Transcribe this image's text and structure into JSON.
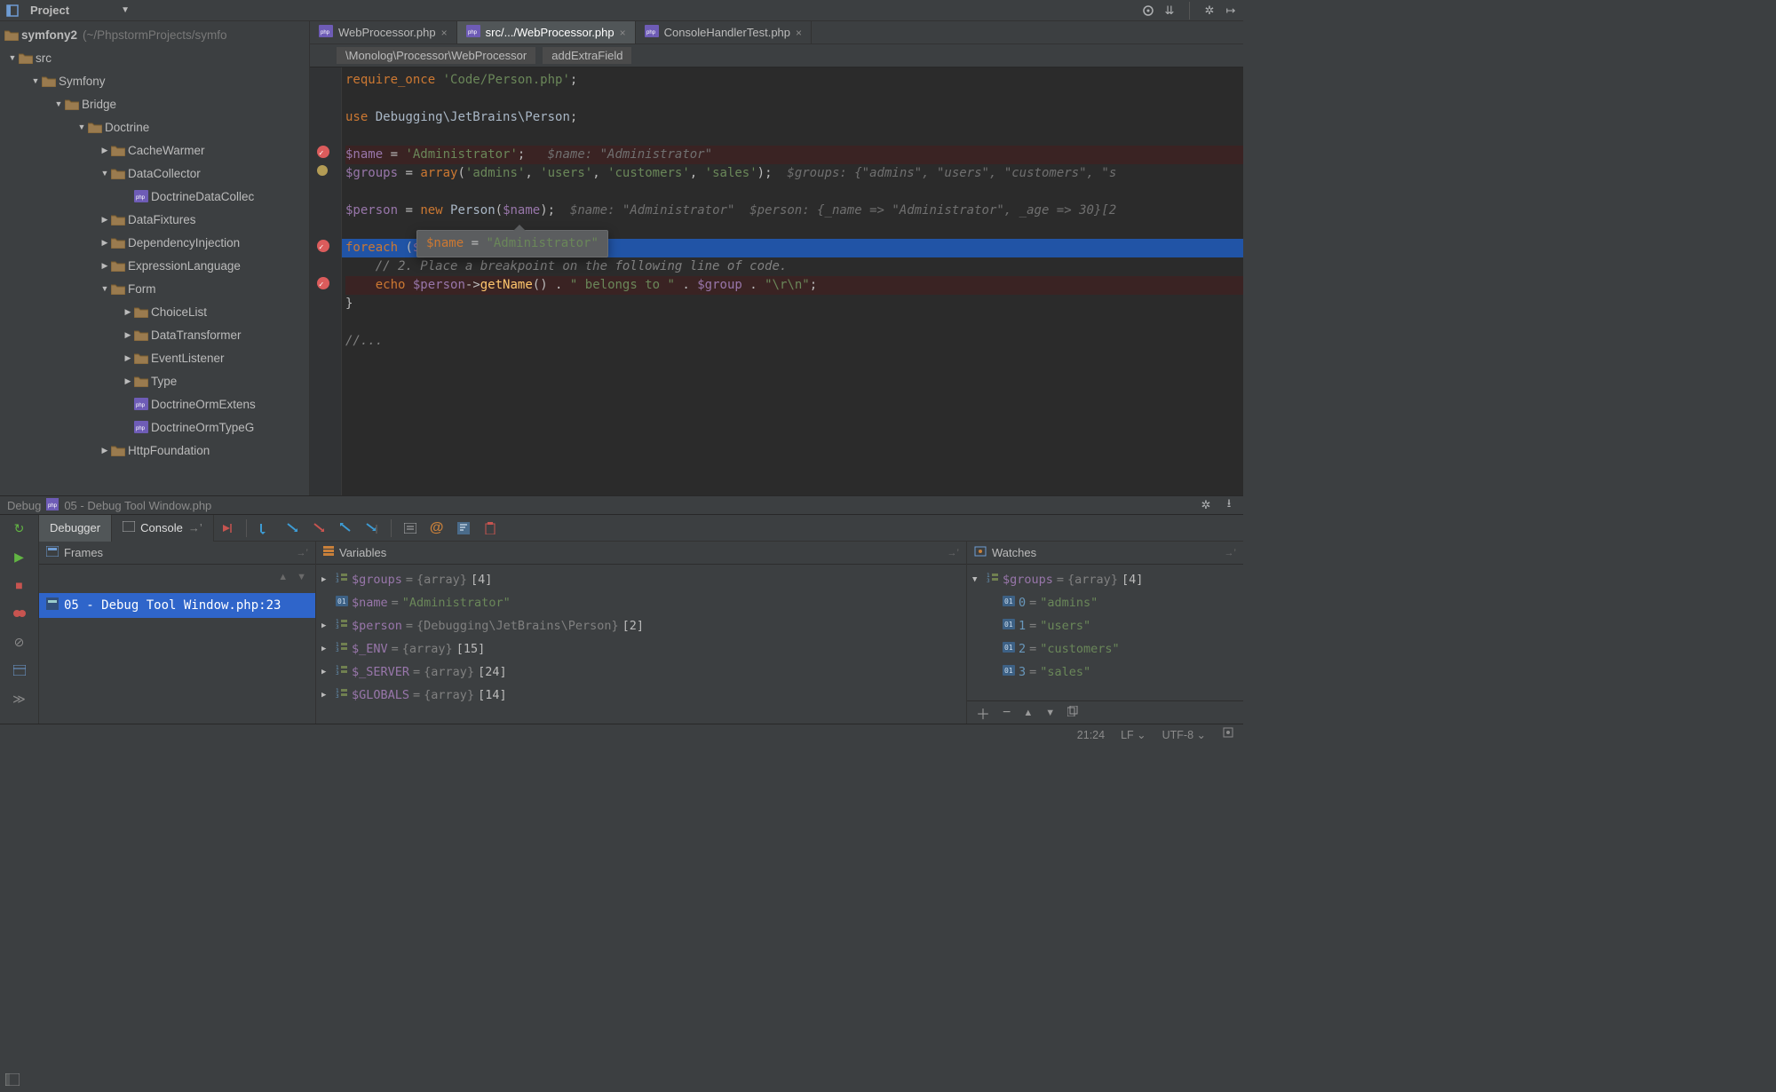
{
  "toolbar": {
    "project_label": "Project"
  },
  "project": {
    "root": "symfony2",
    "root_hint": "(~/PhpstormProjects/symfo",
    "tree": [
      {
        "lvl": 0,
        "open": true,
        "type": "folder",
        "label": "src"
      },
      {
        "lvl": 1,
        "open": true,
        "type": "folder",
        "label": "Symfony"
      },
      {
        "lvl": 2,
        "open": true,
        "type": "folder",
        "label": "Bridge"
      },
      {
        "lvl": 3,
        "open": true,
        "type": "folder",
        "label": "Doctrine"
      },
      {
        "lvl": 4,
        "open": false,
        "type": "folder",
        "label": "CacheWarmer"
      },
      {
        "lvl": 4,
        "open": true,
        "type": "folder",
        "label": "DataCollector"
      },
      {
        "lvl": 5,
        "type": "php",
        "label": "DoctrineDataCollec"
      },
      {
        "lvl": 4,
        "open": false,
        "type": "folder",
        "label": "DataFixtures"
      },
      {
        "lvl": 4,
        "open": false,
        "type": "folder",
        "label": "DependencyInjection"
      },
      {
        "lvl": 4,
        "open": false,
        "type": "folder",
        "label": "ExpressionLanguage"
      },
      {
        "lvl": 4,
        "open": true,
        "type": "folder",
        "label": "Form"
      },
      {
        "lvl": 5,
        "open": false,
        "type": "folder",
        "label": "ChoiceList"
      },
      {
        "lvl": 5,
        "open": false,
        "type": "folder",
        "label": "DataTransformer"
      },
      {
        "lvl": 5,
        "open": false,
        "type": "folder",
        "label": "EventListener"
      },
      {
        "lvl": 5,
        "open": false,
        "type": "folder",
        "label": "Type"
      },
      {
        "lvl": 5,
        "type": "php",
        "label": "DoctrineOrmExtens"
      },
      {
        "lvl": 5,
        "type": "php",
        "label": "DoctrineOrmTypeG"
      },
      {
        "lvl": 4,
        "open": false,
        "type": "folder",
        "label": "HttpFoundation"
      }
    ]
  },
  "tabs": [
    {
      "label": "WebProcessor.php",
      "active": false
    },
    {
      "label": "src/.../WebProcessor.php",
      "active": true
    },
    {
      "label": "ConsoleHandlerTest.php",
      "active": false
    }
  ],
  "breadcrumb": [
    "\\Monolog\\Processor\\WebProcessor",
    "addExtraField"
  ],
  "tooltip": {
    "var": "$name",
    "val": "\"Administrator\""
  },
  "debug": {
    "title_prefix": "Debug",
    "title": "05 - Debug Tool Window.php",
    "tabs": {
      "debugger": "Debugger",
      "console": "Console"
    },
    "frames_title": "Frames",
    "frame_item": "05 - Debug Tool Window.php:23",
    "vars_title": "Variables",
    "watch_title": "Watches",
    "variables": [
      {
        "name": "$groups",
        "type": "{array}",
        "extra": "[4]",
        "arrow": true
      },
      {
        "name": "$name",
        "val": "\"Administrator\"",
        "icon": "str"
      },
      {
        "name": "$person",
        "type": "{Debugging\\JetBrains\\Person}",
        "extra": "[2]",
        "arrow": true
      },
      {
        "name": "$_ENV",
        "type": "{array}",
        "extra": "[15]",
        "arrow": true
      },
      {
        "name": "$_SERVER",
        "type": "{array}",
        "extra": "[24]",
        "arrow": true
      },
      {
        "name": "$GLOBALS",
        "type": "{array}",
        "extra": "[14]",
        "arrow": true
      }
    ],
    "watches_root": {
      "name": "$groups",
      "type": "{array}",
      "extra": "[4]"
    },
    "watches": [
      {
        "key": "0",
        "val": "\"admins\""
      },
      {
        "key": "1",
        "val": "\"users\""
      },
      {
        "key": "2",
        "val": "\"customers\""
      },
      {
        "key": "3",
        "val": "\"sales\""
      }
    ]
  },
  "status": {
    "pos": "21:24",
    "le": "LF",
    "enc": "UTF-8"
  }
}
